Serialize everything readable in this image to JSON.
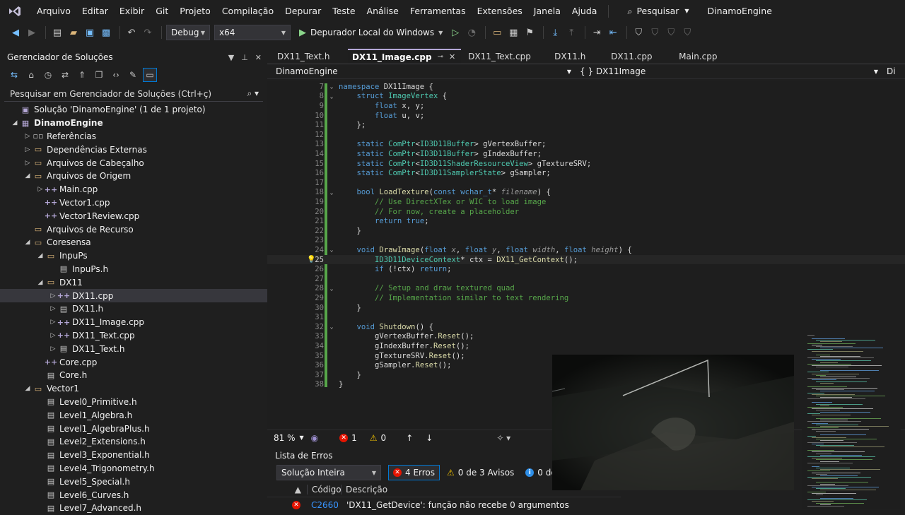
{
  "menubar": {
    "items": [
      "Arquivo",
      "Editar",
      "Exibir",
      "Git",
      "Projeto",
      "Compilação",
      "Depurar",
      "Teste",
      "Análise",
      "Ferramentas",
      "Extensões",
      "Janela",
      "Ajuda"
    ],
    "search_label": "Pesquisar",
    "app_title": "DinamoEngine"
  },
  "toolbar": {
    "configuration": "Debug",
    "platform": "x64",
    "debugger_label": "Depurador Local do Windows"
  },
  "solution_explorer": {
    "title": "Gerenciador de Soluções",
    "search_placeholder": "Pesquisar em Gerenciador de Soluções (Ctrl+ç)",
    "tree": [
      {
        "label": "Solução 'DinamoEngine' (1 de 1 projeto)",
        "depth": 0,
        "expander": "",
        "icon": "solution-icon"
      },
      {
        "label": "DinamoEngine",
        "depth": 0,
        "expander": "open",
        "icon": "project-icon",
        "bold": true
      },
      {
        "label": "Referências",
        "depth": 1,
        "expander": "closed",
        "icon": "references-icon"
      },
      {
        "label": "Dependências Externas",
        "depth": 1,
        "expander": "closed",
        "icon": "folder-icon"
      },
      {
        "label": "Arquivos de Cabeçalho",
        "depth": 1,
        "expander": "closed",
        "icon": "folder-icon"
      },
      {
        "label": "Arquivos de Origem",
        "depth": 1,
        "expander": "open",
        "icon": "folder-icon"
      },
      {
        "label": "Main.cpp",
        "depth": 2,
        "expander": "closed",
        "icon": "cpp-file-icon"
      },
      {
        "label": "Vector1.cpp",
        "depth": 2,
        "expander": "",
        "icon": "cpp-file-icon"
      },
      {
        "label": "Vector1Review.cpp",
        "depth": 2,
        "expander": "",
        "icon": "cpp-file-icon"
      },
      {
        "label": "Arquivos de Recurso",
        "depth": 1,
        "expander": "",
        "icon": "folder-icon"
      },
      {
        "label": "Coresensa",
        "depth": 1,
        "expander": "open",
        "icon": "folder-icon"
      },
      {
        "label": "InpuPs",
        "depth": 2,
        "expander": "open",
        "icon": "folder-icon"
      },
      {
        "label": "InpuPs.h",
        "depth": 3,
        "expander": "",
        "icon": "header-file-icon"
      },
      {
        "label": "DX11",
        "depth": 2,
        "expander": "open",
        "icon": "folder-icon"
      },
      {
        "label": "DX11.cpp",
        "depth": 3,
        "expander": "closed",
        "icon": "cpp-file-icon",
        "selected": true
      },
      {
        "label": "DX11.h",
        "depth": 3,
        "expander": "closed",
        "icon": "header-file-icon"
      },
      {
        "label": "DX11_Image.cpp",
        "depth": 3,
        "expander": "closed",
        "icon": "cpp-file-icon"
      },
      {
        "label": "DX11_Text.cpp",
        "depth": 3,
        "expander": "closed",
        "icon": "cpp-file-icon"
      },
      {
        "label": "DX11_Text.h",
        "depth": 3,
        "expander": "closed",
        "icon": "header-file-icon"
      },
      {
        "label": "Core.cpp",
        "depth": 2,
        "expander": "",
        "icon": "cpp-file-icon"
      },
      {
        "label": "Core.h",
        "depth": 2,
        "expander": "",
        "icon": "header-file-icon"
      },
      {
        "label": "Vector1",
        "depth": 1,
        "expander": "open",
        "icon": "folder-icon"
      },
      {
        "label": "Level0_Primitive.h",
        "depth": 2,
        "expander": "",
        "icon": "header-file-icon"
      },
      {
        "label": "Level1_Algebra.h",
        "depth": 2,
        "expander": "",
        "icon": "header-file-icon"
      },
      {
        "label": "Level1_AlgebraPlus.h",
        "depth": 2,
        "expander": "",
        "icon": "header-file-icon"
      },
      {
        "label": "Level2_Extensions.h",
        "depth": 2,
        "expander": "",
        "icon": "header-file-icon"
      },
      {
        "label": "Level3_Exponential.h",
        "depth": 2,
        "expander": "",
        "icon": "header-file-icon"
      },
      {
        "label": "Level4_Trigonometry.h",
        "depth": 2,
        "expander": "",
        "icon": "header-file-icon"
      },
      {
        "label": "Level5_Special.h",
        "depth": 2,
        "expander": "",
        "icon": "header-file-icon"
      },
      {
        "label": "Level6_Curves.h",
        "depth": 2,
        "expander": "",
        "icon": "header-file-icon"
      },
      {
        "label": "Level7_Advanced.h",
        "depth": 2,
        "expander": "",
        "icon": "header-file-icon"
      }
    ]
  },
  "editor": {
    "tabs": [
      {
        "label": "DX11_Text.h",
        "active": false
      },
      {
        "label": "DX11_Image.cpp",
        "active": true
      },
      {
        "label": "DX11_Text.cpp",
        "active": false
      },
      {
        "label": "DX11.h",
        "active": false
      },
      {
        "label": "DX11.cpp",
        "active": false
      },
      {
        "label": "Main.cpp",
        "active": false
      }
    ],
    "nav_project": "DinamoEngine",
    "nav_scope": "{ } DX11Image",
    "nav_member": "Di",
    "current_line": "25",
    "lines": [
      {
        "n": "7",
        "fold": "v",
        "code": [
          [
            "kw",
            "namespace "
          ],
          [
            "vr",
            "DX11Image {"
          ]
        ]
      },
      {
        "n": "8",
        "fold": "v",
        "code": [
          [
            "vr",
            "    "
          ],
          [
            "kw",
            "struct "
          ],
          [
            "ty",
            "ImageVertex"
          ],
          [
            "vr",
            " {"
          ]
        ]
      },
      {
        "n": "9",
        "fold": "",
        "code": [
          [
            "vr",
            "        "
          ],
          [
            "kw",
            "float "
          ],
          [
            "vr",
            "x, y;"
          ]
        ]
      },
      {
        "n": "10",
        "fold": "",
        "code": [
          [
            "vr",
            "        "
          ],
          [
            "kw",
            "float "
          ],
          [
            "vr",
            "u, v;"
          ]
        ]
      },
      {
        "n": "11",
        "fold": "",
        "code": [
          [
            "vr",
            "    };"
          ]
        ]
      },
      {
        "n": "12",
        "fold": "",
        "code": []
      },
      {
        "n": "13",
        "fold": "",
        "code": [
          [
            "vr",
            "    "
          ],
          [
            "kw",
            "static "
          ],
          [
            "ty",
            "ComPtr"
          ],
          [
            "vr",
            "<"
          ],
          [
            "ty",
            "ID3D11Buffer"
          ],
          [
            "vr",
            "> gVertexBuffer;"
          ]
        ]
      },
      {
        "n": "14",
        "fold": "",
        "code": [
          [
            "vr",
            "    "
          ],
          [
            "kw",
            "static "
          ],
          [
            "ty",
            "ComPtr"
          ],
          [
            "vr",
            "<"
          ],
          [
            "ty",
            "ID3D11Buffer"
          ],
          [
            "vr",
            "> gIndexBuffer;"
          ]
        ]
      },
      {
        "n": "15",
        "fold": "",
        "code": [
          [
            "vr",
            "    "
          ],
          [
            "kw",
            "static "
          ],
          [
            "ty",
            "ComPtr"
          ],
          [
            "vr",
            "<"
          ],
          [
            "ty",
            "ID3D11ShaderResourceView"
          ],
          [
            "vr",
            "> gTextureSRV;"
          ]
        ]
      },
      {
        "n": "16",
        "fold": "",
        "code": [
          [
            "vr",
            "    "
          ],
          [
            "kw",
            "static "
          ],
          [
            "ty",
            "ComPtr"
          ],
          [
            "vr",
            "<"
          ],
          [
            "ty",
            "ID3D11SamplerState"
          ],
          [
            "vr",
            "> gSampler;"
          ]
        ]
      },
      {
        "n": "17",
        "fold": "",
        "code": []
      },
      {
        "n": "18",
        "fold": "v",
        "code": [
          [
            "vr",
            "    "
          ],
          [
            "kw",
            "bool "
          ],
          [
            "fn",
            "LoadTexture"
          ],
          [
            "vr",
            "("
          ],
          [
            "kw",
            "const "
          ],
          [
            "kw",
            "wchar_t"
          ],
          [
            "vr",
            "* "
          ],
          [
            "pm",
            "filename"
          ],
          [
            "vr",
            ") {"
          ]
        ]
      },
      {
        "n": "19",
        "fold": "",
        "code": [
          [
            "vr",
            "        "
          ],
          [
            "cm",
            "// Use DirectXTex or WIC to load image"
          ]
        ]
      },
      {
        "n": "20",
        "fold": "",
        "code": [
          [
            "vr",
            "        "
          ],
          [
            "cm",
            "// For now, create a placeholder"
          ]
        ]
      },
      {
        "n": "21",
        "fold": "",
        "code": [
          [
            "vr",
            "        "
          ],
          [
            "kw",
            "return "
          ],
          [
            "kw",
            "true"
          ],
          [
            "vr",
            ";"
          ]
        ]
      },
      {
        "n": "22",
        "fold": "",
        "code": [
          [
            "vr",
            "    }"
          ]
        ]
      },
      {
        "n": "23",
        "fold": "",
        "code": []
      },
      {
        "n": "24",
        "fold": "v",
        "code": [
          [
            "vr",
            "    "
          ],
          [
            "kw",
            "void "
          ],
          [
            "fn",
            "DrawImage"
          ],
          [
            "vr",
            "("
          ],
          [
            "kw",
            "float "
          ],
          [
            "pm",
            "x"
          ],
          [
            "vr",
            ", "
          ],
          [
            "kw",
            "float "
          ],
          [
            "pm",
            "y"
          ],
          [
            "vr",
            ", "
          ],
          [
            "kw",
            "float "
          ],
          [
            "pm",
            "width"
          ],
          [
            "vr",
            ", "
          ],
          [
            "kw",
            "float "
          ],
          [
            "pm",
            "height"
          ],
          [
            "vr",
            ") {"
          ]
        ]
      },
      {
        "n": "25",
        "fold": "",
        "code": [
          [
            "vr",
            "        "
          ],
          [
            "ty",
            "ID3D11DeviceContext"
          ],
          [
            "vr",
            "* ctx = "
          ],
          [
            "fn",
            "DX11_GetContext"
          ],
          [
            "vr",
            "();"
          ]
        ]
      },
      {
        "n": "26",
        "fold": "",
        "code": [
          [
            "vr",
            "        "
          ],
          [
            "kw",
            "if "
          ],
          [
            "vr",
            "(!ctx) "
          ],
          [
            "kw",
            "return"
          ],
          [
            "vr",
            ";"
          ]
        ]
      },
      {
        "n": "27",
        "fold": "",
        "code": []
      },
      {
        "n": "28",
        "fold": "v",
        "code": [
          [
            "vr",
            "        "
          ],
          [
            "cm",
            "// Setup and draw textured quad"
          ]
        ]
      },
      {
        "n": "29",
        "fold": "",
        "code": [
          [
            "vr",
            "        "
          ],
          [
            "cm",
            "// Implementation similar to text rendering"
          ]
        ]
      },
      {
        "n": "30",
        "fold": "",
        "code": [
          [
            "vr",
            "    }"
          ]
        ]
      },
      {
        "n": "31",
        "fold": "",
        "code": []
      },
      {
        "n": "32",
        "fold": "v",
        "code": [
          [
            "vr",
            "    "
          ],
          [
            "kw",
            "void "
          ],
          [
            "fn",
            "Shutdown"
          ],
          [
            "vr",
            "() {"
          ]
        ]
      },
      {
        "n": "33",
        "fold": "",
        "code": [
          [
            "vr",
            "        gVertexBuffer."
          ],
          [
            "fn",
            "Reset"
          ],
          [
            "vr",
            "();"
          ]
        ]
      },
      {
        "n": "34",
        "fold": "",
        "code": [
          [
            "vr",
            "        gIndexBuffer."
          ],
          [
            "fn",
            "Reset"
          ],
          [
            "vr",
            "();"
          ]
        ]
      },
      {
        "n": "35",
        "fold": "",
        "code": [
          [
            "vr",
            "        gTextureSRV."
          ],
          [
            "fn",
            "Reset"
          ],
          [
            "vr",
            "();"
          ]
        ]
      },
      {
        "n": "36",
        "fold": "",
        "code": [
          [
            "vr",
            "        gSampler."
          ],
          [
            "fn",
            "Reset"
          ],
          [
            "vr",
            "();"
          ]
        ]
      },
      {
        "n": "37",
        "fold": "",
        "code": [
          [
            "vr",
            "    }"
          ]
        ]
      },
      {
        "n": "38",
        "fold": "",
        "code": [
          [
            "vr",
            "}"
          ]
        ]
      }
    ]
  },
  "status": {
    "zoom": "81 %",
    "errors": "1",
    "warnings": "0"
  },
  "error_list": {
    "title": "Lista de Erros",
    "scope": "Solução Inteira",
    "errors_badge": "4 Erros",
    "warnings_badge": "0 de 3 Avisos",
    "messages_badge": "0 de 4",
    "col_code": "Código",
    "col_desc": "Descrição",
    "rows": [
      {
        "code": "C2660",
        "desc": "'DX11_GetDevice': função não recebe 0 argumentos"
      }
    ]
  },
  "colors": {
    "accent": "#b4a7d6",
    "keyword": "#569cd6",
    "type": "#4ec9b0",
    "function": "#dcdcaa",
    "comment": "#57a64a",
    "error": "#e51400",
    "warning": "#f0c000"
  }
}
